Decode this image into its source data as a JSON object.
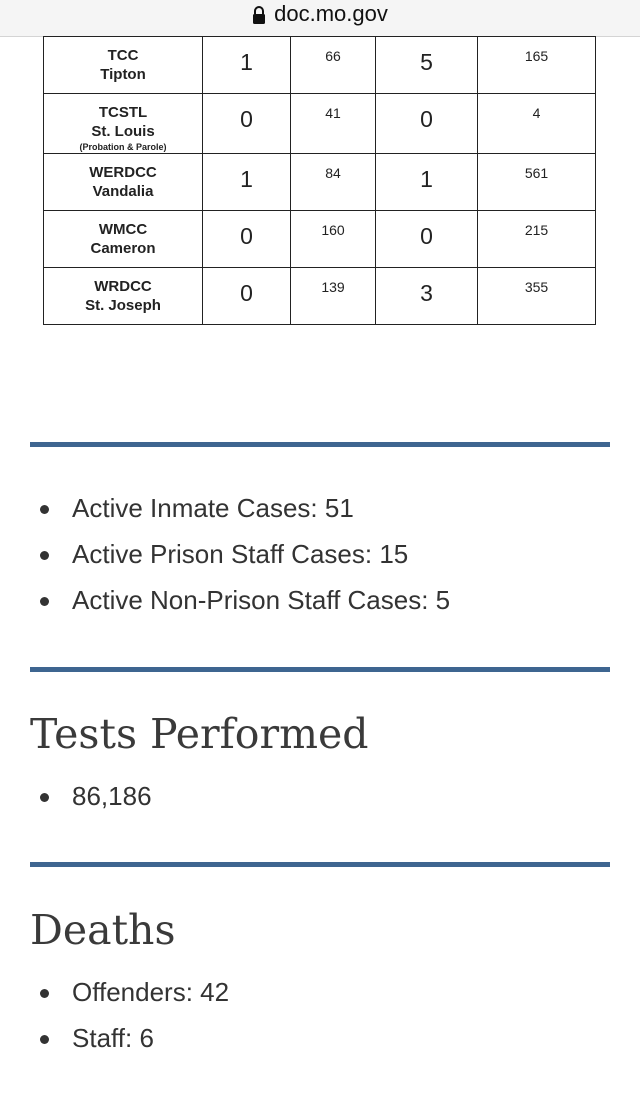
{
  "browser": {
    "url": "doc.mo.gov"
  },
  "table": {
    "rows": [
      {
        "code": "TCC",
        "city": "Tipton",
        "note": "",
        "c1": "1",
        "c2": "66",
        "c3": "5",
        "c4": "165"
      },
      {
        "code": "TCSTL",
        "city": "St. Louis",
        "note": "(Probation & Parole)",
        "c1": "0",
        "c2": "41",
        "c3": "0",
        "c4": "4"
      },
      {
        "code": "WERDCC",
        "city": "Vandalia",
        "note": "",
        "c1": "1",
        "c2": "84",
        "c3": "1",
        "c4": "561"
      },
      {
        "code": "WMCC",
        "city": "Cameron",
        "note": "",
        "c1": "0",
        "c2": "160",
        "c3": "0",
        "c4": "215"
      },
      {
        "code": "WRDCC",
        "city": "St. Joseph",
        "note": "",
        "c1": "0",
        "c2": "139",
        "c3": "3",
        "c4": "355"
      }
    ]
  },
  "active_cases": [
    "Active Inmate Cases: 51",
    "Active Prison Staff Cases: 15",
    "Active Non-Prison Staff Cases: 5"
  ],
  "tests": {
    "heading": "Tests Performed",
    "items": [
      "86,186"
    ]
  },
  "deaths": {
    "heading": "Deaths",
    "items": [
      "Offenders: 42",
      "Staff: 6"
    ]
  },
  "colors": {
    "rule": "#3e6590"
  }
}
